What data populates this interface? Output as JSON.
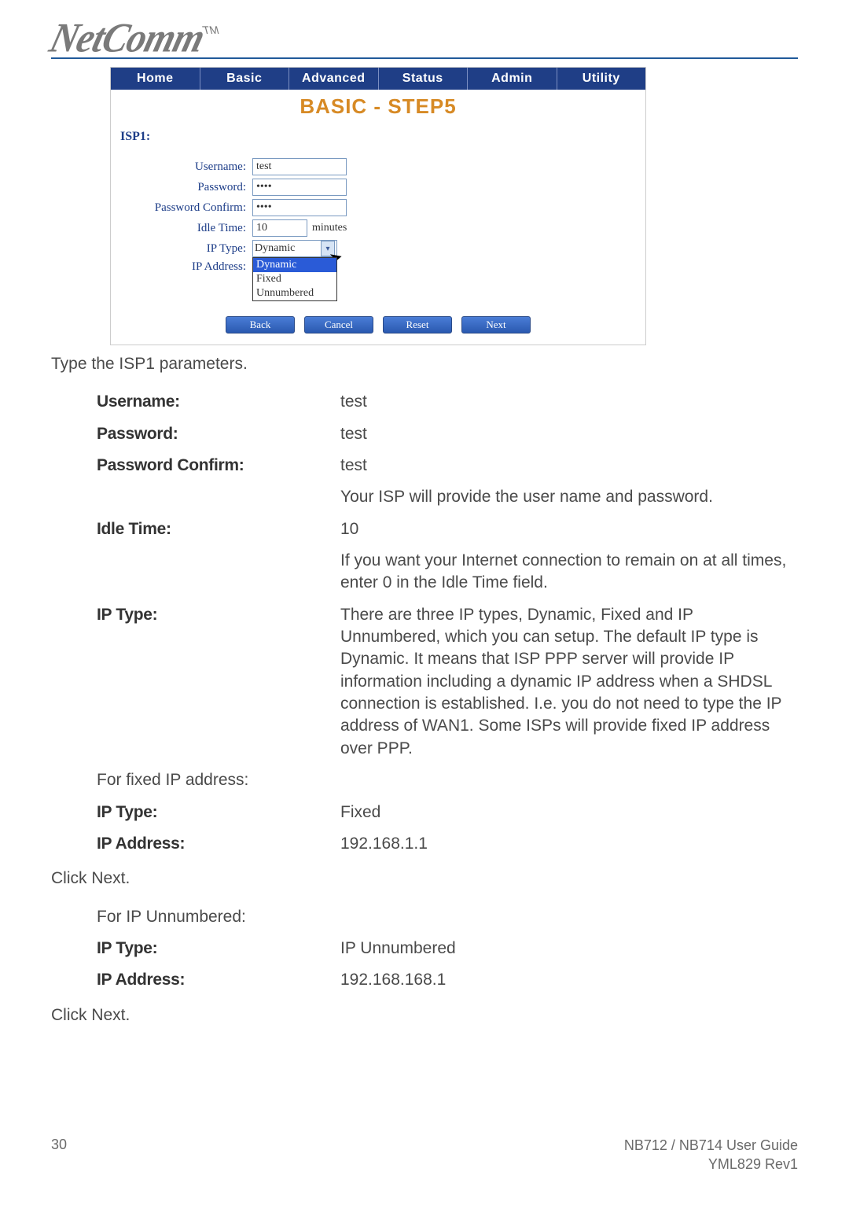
{
  "logo": {
    "text": "NetComm",
    "tm": "TM"
  },
  "nav": {
    "items": [
      "Home",
      "Basic",
      "Advanced",
      "Status",
      "Admin",
      "Utility"
    ]
  },
  "screen": {
    "title": "BASIC - STEP5",
    "section": "ISP1:",
    "labels": {
      "username": "Username:",
      "password": "Password:",
      "pwconfirm": "Password Confirm:",
      "idle": "Idle Time:",
      "idle_unit": "minutes",
      "iptype": "IP Type:",
      "ipaddr": "IP Address:"
    },
    "values": {
      "username": "test",
      "password": "••••",
      "pwconfirm": "••••",
      "idle": "10",
      "iptype": "Dynamic"
    },
    "options": [
      "Dynamic",
      "Fixed",
      "Unnumbered"
    ],
    "buttons": [
      "Back",
      "Cancel",
      "Reset",
      "Next"
    ]
  },
  "body": {
    "caption": "Type the ISP1 parameters.",
    "rows1": {
      "username_label": "Username:",
      "username_val": "test",
      "password_label": "Password:",
      "password_val": "test",
      "pwconfirm_label": "Password Confirm:",
      "pwconfirm_val": "test",
      "pwnote": "Your ISP will provide the user name and password.",
      "idle_label": "Idle Time:",
      "idle_val": "10",
      "idle_note": "If you want your Internet connection to remain on at all times, enter 0 in the Idle Time field.",
      "iptype_label": "IP Type:",
      "iptype_text": "There are three IP types, Dynamic, Fixed and IP Unnumbered, which you can setup. The default IP type is Dynamic. It means that ISP PPP server will provide IP information including a dynamic IP address when a SHDSL connection is established. I.e. you do not need to type the IP address of WAN1. Some ISPs will provide fixed IP address over PPP."
    },
    "fixed": {
      "heading": "For fixed IP address:",
      "iptype_label": "IP Type:",
      "iptype_val": "Fixed",
      "ipaddr_label": "IP Address:",
      "ipaddr_val": "192.168.1.1"
    },
    "click1": "Click Next.",
    "unnum": {
      "heading": "For IP Unnumbered:",
      "iptype_label": "IP Type:",
      "iptype_val": "IP Unnumbered",
      "ipaddr_label": "IP Address:",
      "ipaddr_val": "192.168.168.1"
    },
    "click2": "Click Next."
  },
  "footer": {
    "page": "30",
    "guide": "NB712 / NB714 User Guide",
    "rev": "YML829 Rev1"
  }
}
